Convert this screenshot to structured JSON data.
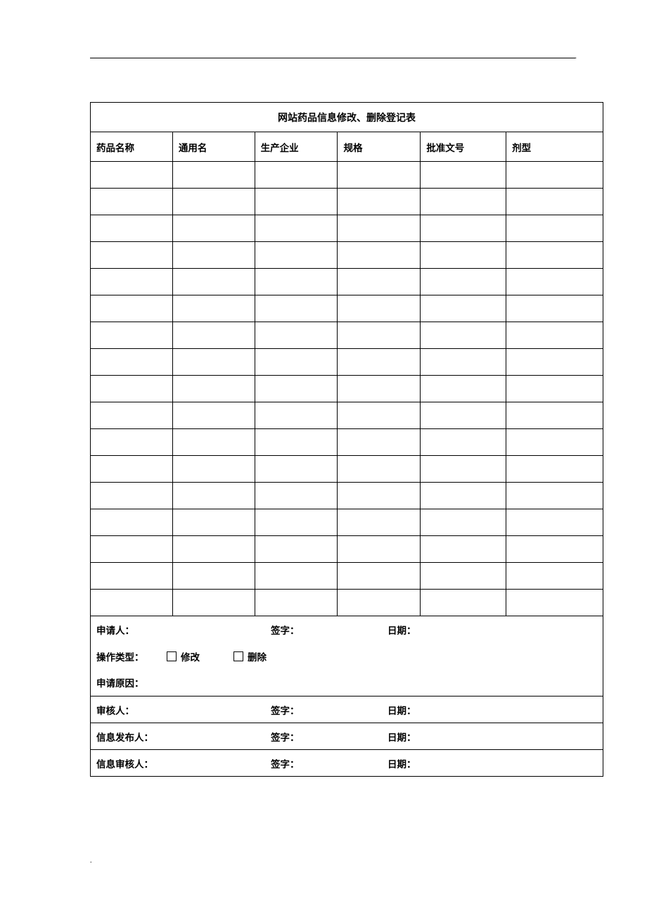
{
  "top_dot": ".",
  "bottom_dot": ".",
  "table": {
    "title": "网站药品信息修改、删除登记表",
    "headers": [
      "药品名称",
      "通用名",
      "生产企业",
      "规格",
      "批准文号",
      "剂型"
    ],
    "data_row_count": 17
  },
  "signatures": {
    "applicant": {
      "label": "申请人：",
      "sign_label": "签字：",
      "date_label": "日期："
    },
    "op_type": {
      "label": "操作类型：",
      "option_modify": "修改",
      "option_delete": "删除"
    },
    "reason": {
      "label": "申请原因："
    },
    "reviewer": {
      "label": "审核人：",
      "sign_label": "签字：",
      "date_label": "日期："
    },
    "publisher": {
      "label": "信息发布人：",
      "sign_label": "签字：",
      "date_label": "日期："
    },
    "info_reviewer": {
      "label": "信息审核人：",
      "sign_label": "签字：",
      "date_label": "日期："
    }
  }
}
